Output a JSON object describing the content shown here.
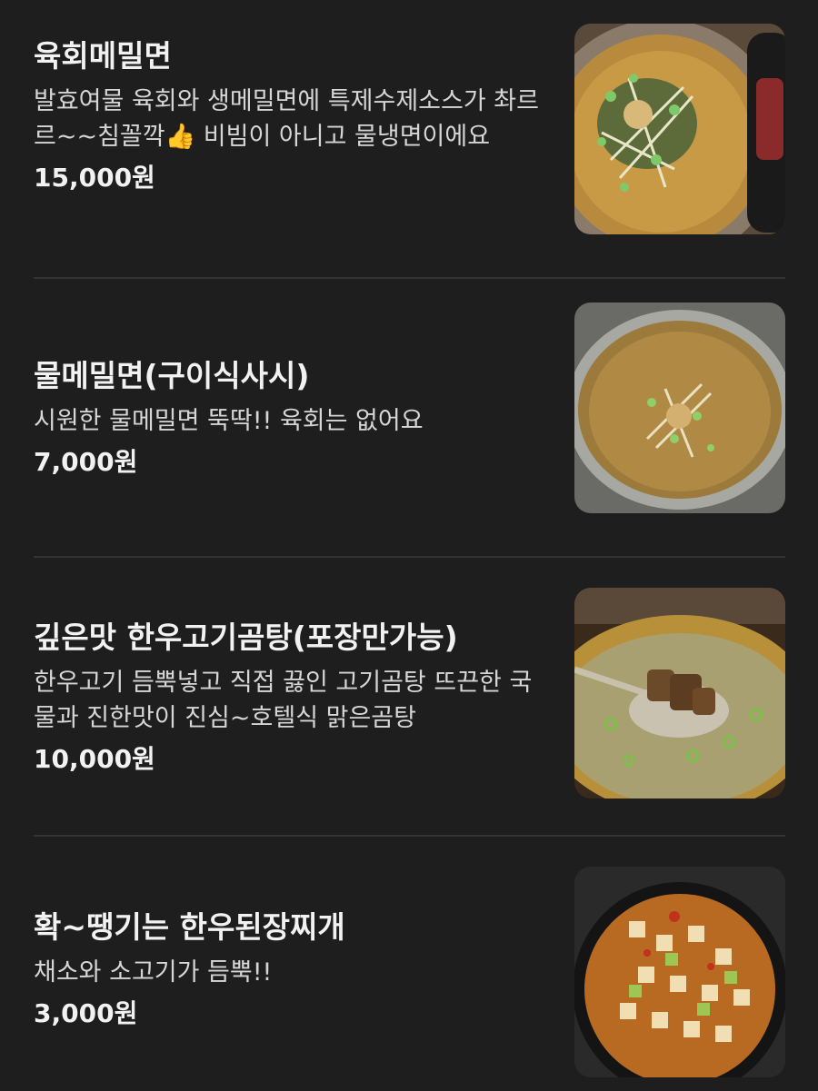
{
  "menu": {
    "items": [
      {
        "name": "육회메밀면",
        "description": "발효여물 육회와 생메밀면에 특제수제소스가 촤르르~~침꼴깍👍 비빔이 아니고 물냉면이에요",
        "price": "15,000원",
        "image_icon": "buckwheat-noodle-with-yukhoe-photo"
      },
      {
        "name": "물메밀면(구이식사시)",
        "description": "시원한 물메밀면 뚝딱!! 육회는 없어요",
        "price": "7,000원",
        "image_icon": "cold-buckwheat-noodle-photo"
      },
      {
        "name": "깊은맛 한우고기곰탕(포장만가능)",
        "description": "한우고기 듬뿍넣고 직접 끓인 고기곰탕 뜨끈한 국물과 진한맛이 진심~호텔식 맑은곰탕",
        "price": "10,000원",
        "image_icon": "beef-bone-soup-photo"
      },
      {
        "name": "확~땡기는 한우된장찌개",
        "description": "채소와 소고기가 듬뿍!!",
        "price": "3,000원",
        "image_icon": "soybean-paste-stew-photo"
      }
    ]
  }
}
